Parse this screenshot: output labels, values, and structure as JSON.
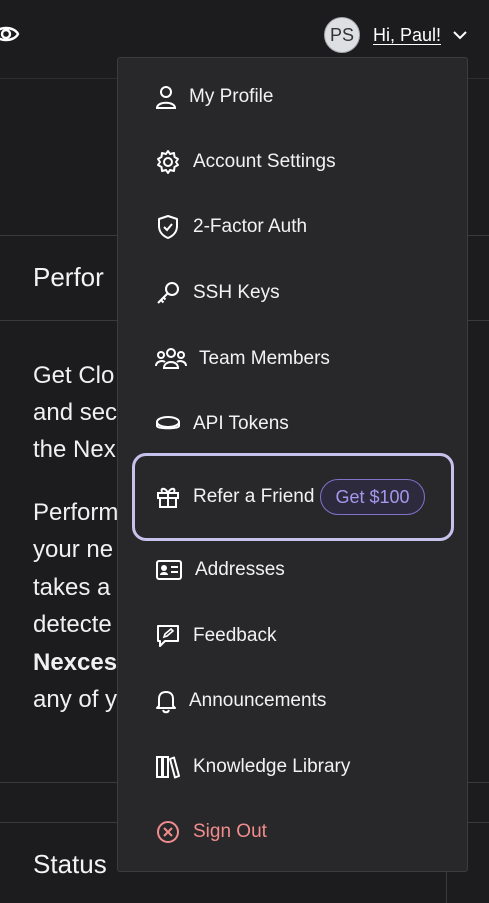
{
  "header": {
    "avatar_initials": "PS",
    "greeting": "Hi, Paul!"
  },
  "background": {
    "section_title_1": "Perfor",
    "para1_lines": [
      "Get Clo",
      "and sec",
      "the Nex"
    ],
    "para2_lines": [
      "Perform",
      "your ne",
      "takes a",
      "detecte"
    ],
    "para2_bold": "Nexces",
    "para2_last": "any of y",
    "section_title_2": "Status"
  },
  "menu": {
    "items": [
      {
        "label": "My Profile",
        "icon": "user-icon"
      },
      {
        "label": "Account Settings",
        "icon": "gear-icon"
      },
      {
        "label": "2-Factor Auth",
        "icon": "shield-check-icon"
      },
      {
        "label": "SSH Keys",
        "icon": "key-icon"
      },
      {
        "label": "Team Members",
        "icon": "team-icon"
      },
      {
        "label": "API Tokens",
        "icon": "token-icon"
      },
      {
        "label": "Refer a Friend",
        "icon": "gift-icon",
        "badge": "Get $100"
      },
      {
        "label": "Addresses",
        "icon": "address-card-icon"
      },
      {
        "label": "Feedback",
        "icon": "feedback-icon"
      },
      {
        "label": "Announcements",
        "icon": "bell-icon"
      },
      {
        "label": "Knowledge Library",
        "icon": "books-icon"
      },
      {
        "label": "Sign Out",
        "icon": "sign-out-icon"
      }
    ]
  },
  "colors": {
    "background": "#1c1c1e",
    "menu_bg": "#28282a",
    "highlight_border": "#c7c2ec",
    "badge_text": "#a498ec",
    "sign_out": "#f18c8c"
  }
}
